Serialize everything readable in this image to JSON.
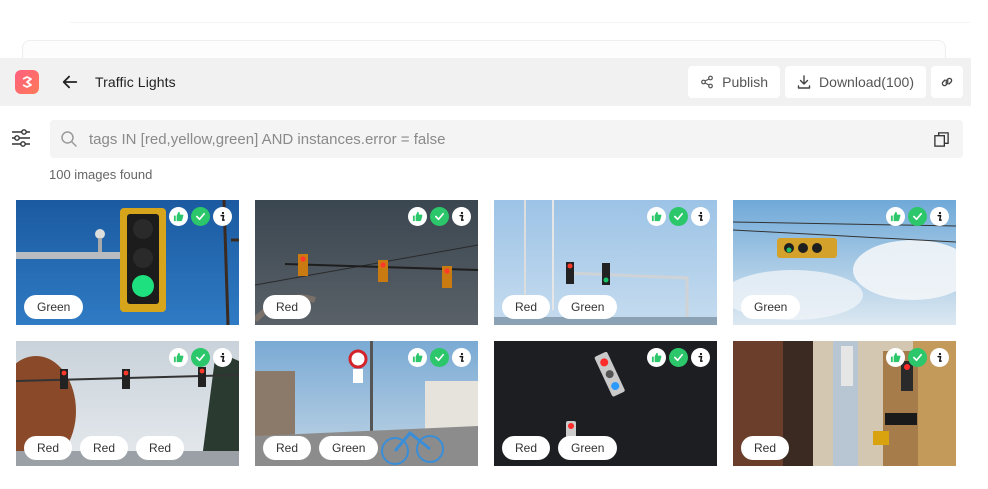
{
  "header": {
    "title": "Traffic Lights",
    "publish_label": "Publish",
    "download_label": "Download(100)"
  },
  "search": {
    "query": "tags IN [red,yellow,green] AND instances.error = false"
  },
  "results": {
    "count_text": "100 images found"
  },
  "colors": {
    "badge_green": "#2cc76a",
    "logo_gradient_start": "#ff5f7e",
    "logo_gradient_end": "#ff7a59"
  },
  "images": [
    {
      "tags": [
        "Green"
      ]
    },
    {
      "tags": [
        "Red"
      ]
    },
    {
      "tags": [
        "Red",
        "Green"
      ]
    },
    {
      "tags": [
        "Green"
      ]
    },
    {
      "tags": [
        "Red",
        "Red",
        "Red"
      ]
    },
    {
      "tags": [
        "Red",
        "Green"
      ]
    },
    {
      "tags": [
        "Red",
        "Green"
      ]
    },
    {
      "tags": [
        "Red"
      ]
    }
  ]
}
